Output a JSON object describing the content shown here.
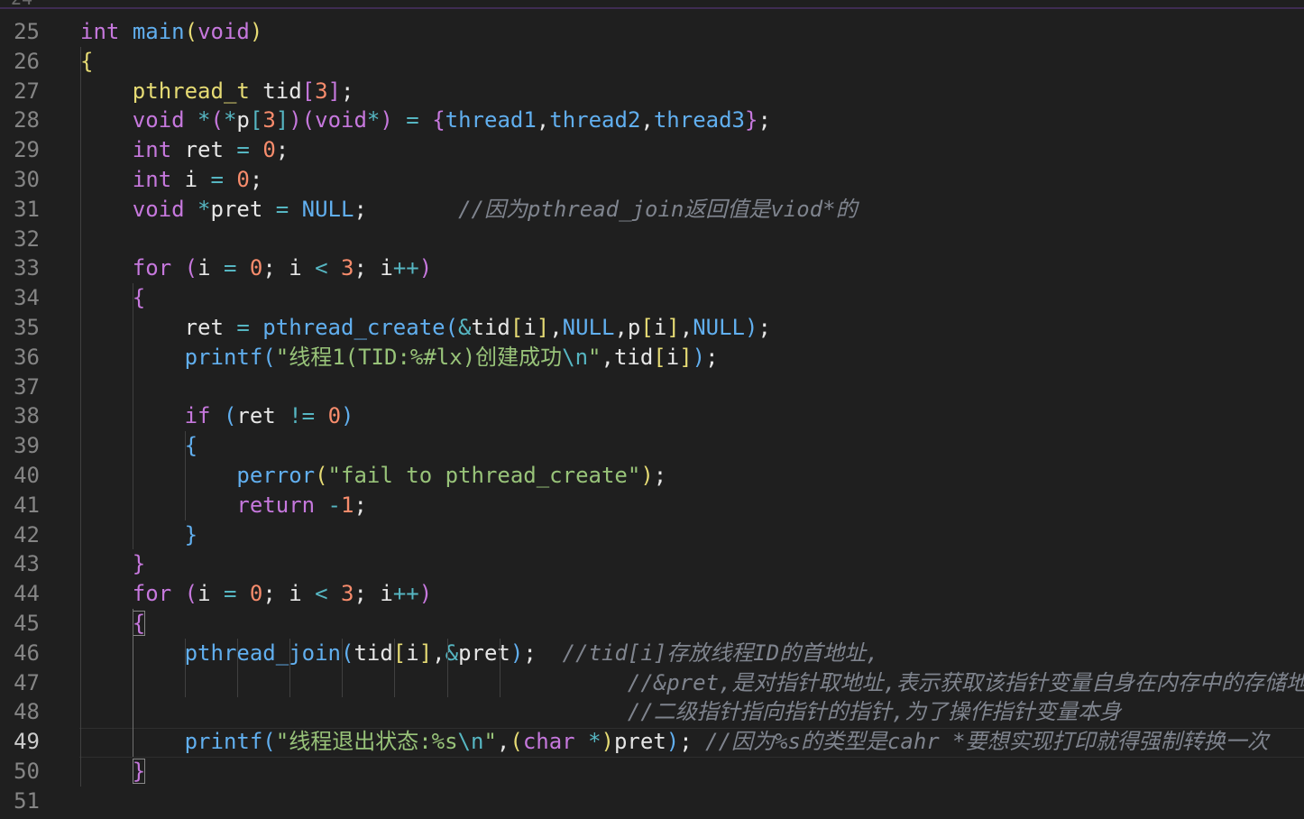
{
  "editor": {
    "partial_top_line": "24",
    "current_line": 49,
    "lines": [
      {
        "n": "25",
        "tokens": [
          [
            "t-purple",
            "int"
          ],
          [
            "t-white",
            " "
          ],
          [
            "t-blue",
            "main"
          ],
          [
            "t-yellow",
            "("
          ],
          [
            "t-purple",
            "void"
          ],
          [
            "t-yellow",
            ")"
          ]
        ]
      },
      {
        "n": "26",
        "tokens": [
          [
            "t-yellow",
            "{"
          ]
        ]
      },
      {
        "n": "27",
        "tokens": [
          [
            "t-white",
            "    "
          ],
          [
            "t-yellow",
            "pthread_t"
          ],
          [
            "t-white",
            " tid"
          ],
          [
            "t-purple",
            "["
          ],
          [
            "t-orange",
            "3"
          ],
          [
            "t-purple",
            "]"
          ],
          [
            "t-white",
            ";"
          ]
        ]
      },
      {
        "n": "28",
        "tokens": [
          [
            "t-white",
            "    "
          ],
          [
            "t-purple",
            "void"
          ],
          [
            "t-white",
            " "
          ],
          [
            "t-cyan",
            "*"
          ],
          [
            "t-purple",
            "("
          ],
          [
            "t-cyan",
            "*"
          ],
          [
            "t-white",
            "p"
          ],
          [
            "t-cyan",
            "["
          ],
          [
            "t-orange",
            "3"
          ],
          [
            "t-cyan",
            "]"
          ],
          [
            "t-purple",
            ")("
          ],
          [
            "t-purple",
            "void"
          ],
          [
            "t-cyan",
            "*"
          ],
          [
            "t-purple",
            ")"
          ],
          [
            "t-white",
            " "
          ],
          [
            "t-cyan",
            "="
          ],
          [
            "t-white",
            " "
          ],
          [
            "t-purple",
            "{"
          ],
          [
            "t-blue",
            "thread1"
          ],
          [
            "t-white",
            ","
          ],
          [
            "t-blue",
            "thread2"
          ],
          [
            "t-white",
            ","
          ],
          [
            "t-blue",
            "thread3"
          ],
          [
            "t-purple",
            "}"
          ],
          [
            "t-white",
            ";"
          ]
        ]
      },
      {
        "n": "29",
        "tokens": [
          [
            "t-white",
            "    "
          ],
          [
            "t-purple",
            "int"
          ],
          [
            "t-white",
            " ret "
          ],
          [
            "t-cyan",
            "="
          ],
          [
            "t-white",
            " "
          ],
          [
            "t-orange",
            "0"
          ],
          [
            "t-white",
            ";"
          ]
        ]
      },
      {
        "n": "30",
        "tokens": [
          [
            "t-white",
            "    "
          ],
          [
            "t-purple",
            "int"
          ],
          [
            "t-white",
            " i "
          ],
          [
            "t-cyan",
            "="
          ],
          [
            "t-white",
            " "
          ],
          [
            "t-orange",
            "0"
          ],
          [
            "t-white",
            ";"
          ]
        ]
      },
      {
        "n": "31",
        "tokens": [
          [
            "t-white",
            "    "
          ],
          [
            "t-purple",
            "void"
          ],
          [
            "t-white",
            " "
          ],
          [
            "t-cyan",
            "*"
          ],
          [
            "t-white",
            "pret "
          ],
          [
            "t-cyan",
            "="
          ],
          [
            "t-white",
            " "
          ],
          [
            "t-blue",
            "NULL"
          ],
          [
            "t-white",
            ";"
          ],
          [
            "t-white",
            "       "
          ],
          [
            "t-comment",
            "//因为pthread_join返回值是viod*的"
          ]
        ]
      },
      {
        "n": "32",
        "tokens": []
      },
      {
        "n": "33",
        "tokens": [
          [
            "t-white",
            "    "
          ],
          [
            "t-purple",
            "for"
          ],
          [
            "t-white",
            " "
          ],
          [
            "t-purple",
            "("
          ],
          [
            "t-white",
            "i "
          ],
          [
            "t-cyan",
            "="
          ],
          [
            "t-white",
            " "
          ],
          [
            "t-orange",
            "0"
          ],
          [
            "t-white",
            "; i "
          ],
          [
            "t-cyan",
            "<"
          ],
          [
            "t-white",
            " "
          ],
          [
            "t-orange",
            "3"
          ],
          [
            "t-white",
            "; i"
          ],
          [
            "t-cyan",
            "++"
          ],
          [
            "t-purple",
            ")"
          ]
        ]
      },
      {
        "n": "34",
        "tokens": [
          [
            "t-white",
            "    "
          ],
          [
            "t-purple",
            "{"
          ]
        ]
      },
      {
        "n": "35",
        "tokens": [
          [
            "t-white",
            "        ret "
          ],
          [
            "t-cyan",
            "="
          ],
          [
            "t-white",
            " "
          ],
          [
            "t-blue",
            "pthread_create"
          ],
          [
            "t-blue",
            "("
          ],
          [
            "t-cyan",
            "&"
          ],
          [
            "t-white",
            "tid"
          ],
          [
            "t-yellow",
            "["
          ],
          [
            "t-white",
            "i"
          ],
          [
            "t-yellow",
            "]"
          ],
          [
            "t-white",
            ","
          ],
          [
            "t-blue",
            "NULL"
          ],
          [
            "t-white",
            ",p"
          ],
          [
            "t-yellow",
            "["
          ],
          [
            "t-white",
            "i"
          ],
          [
            "t-yellow",
            "]"
          ],
          [
            "t-white",
            ","
          ],
          [
            "t-blue",
            "NULL"
          ],
          [
            "t-blue",
            ")"
          ],
          [
            "t-white",
            ";"
          ]
        ]
      },
      {
        "n": "36",
        "tokens": [
          [
            "t-white",
            "        "
          ],
          [
            "t-blue",
            "printf"
          ],
          [
            "t-blue",
            "("
          ],
          [
            "t-green",
            "\"线程1(TID:%#lx)创建成功"
          ],
          [
            "t-cyan",
            "\\n"
          ],
          [
            "t-green",
            "\""
          ],
          [
            "t-white",
            ",tid"
          ],
          [
            "t-yellow",
            "["
          ],
          [
            "t-white",
            "i"
          ],
          [
            "t-yellow",
            "]"
          ],
          [
            "t-blue",
            ")"
          ],
          [
            "t-white",
            ";"
          ]
        ]
      },
      {
        "n": "37",
        "tokens": []
      },
      {
        "n": "38",
        "tokens": [
          [
            "t-white",
            "        "
          ],
          [
            "t-purple",
            "if"
          ],
          [
            "t-white",
            " "
          ],
          [
            "t-blue",
            "("
          ],
          [
            "t-white",
            "ret "
          ],
          [
            "t-cyan",
            "!="
          ],
          [
            "t-white",
            " "
          ],
          [
            "t-orange",
            "0"
          ],
          [
            "t-blue",
            ")"
          ]
        ]
      },
      {
        "n": "39",
        "tokens": [
          [
            "t-white",
            "        "
          ],
          [
            "t-blue",
            "{"
          ]
        ]
      },
      {
        "n": "40",
        "tokens": [
          [
            "t-white",
            "            "
          ],
          [
            "t-blue",
            "perror"
          ],
          [
            "t-yellow",
            "("
          ],
          [
            "t-green",
            "\"fail to pthread_create\""
          ],
          [
            "t-yellow",
            ")"
          ],
          [
            "t-white",
            ";"
          ]
        ]
      },
      {
        "n": "41",
        "tokens": [
          [
            "t-white",
            "            "
          ],
          [
            "t-purple",
            "return"
          ],
          [
            "t-white",
            " "
          ],
          [
            "t-cyan",
            "-"
          ],
          [
            "t-orange",
            "1"
          ],
          [
            "t-white",
            ";"
          ]
        ]
      },
      {
        "n": "42",
        "tokens": [
          [
            "t-white",
            "        "
          ],
          [
            "t-blue",
            "}"
          ]
        ]
      },
      {
        "n": "43",
        "tokens": [
          [
            "t-white",
            "    "
          ],
          [
            "t-purple",
            "}"
          ]
        ]
      },
      {
        "n": "44",
        "tokens": [
          [
            "t-white",
            "    "
          ],
          [
            "t-purple",
            "for"
          ],
          [
            "t-white",
            " "
          ],
          [
            "t-purple",
            "("
          ],
          [
            "t-white",
            "i "
          ],
          [
            "t-cyan",
            "="
          ],
          [
            "t-white",
            " "
          ],
          [
            "t-orange",
            "0"
          ],
          [
            "t-white",
            "; i "
          ],
          [
            "t-cyan",
            "<"
          ],
          [
            "t-white",
            " "
          ],
          [
            "t-orange",
            "3"
          ],
          [
            "t-white",
            "; i"
          ],
          [
            "t-cyan",
            "++"
          ],
          [
            "t-purple",
            ")"
          ]
        ]
      },
      {
        "n": "45",
        "tokens": [
          [
            "t-white",
            "    "
          ],
          [
            "t-purple boxed",
            "{"
          ]
        ]
      },
      {
        "n": "46",
        "tokens": [
          [
            "t-white",
            "        "
          ],
          [
            "t-blue",
            "pthread_join"
          ],
          [
            "t-blue",
            "("
          ],
          [
            "t-white",
            "tid"
          ],
          [
            "t-yellow",
            "["
          ],
          [
            "t-white",
            "i"
          ],
          [
            "t-yellow",
            "]"
          ],
          [
            "t-white",
            ","
          ],
          [
            "t-cyan",
            "&"
          ],
          [
            "t-white",
            "pret"
          ],
          [
            "t-blue",
            ")"
          ],
          [
            "t-white",
            ";  "
          ],
          [
            "t-comment",
            "//tid[i]存放线程ID的首地址,"
          ]
        ]
      },
      {
        "n": "47",
        "tokens": [
          [
            "t-white",
            "                                          "
          ],
          [
            "t-comment",
            "//&pret,是对指针取地址,表示获取该指针变量自身在内存中的存储地址"
          ]
        ]
      },
      {
        "n": "48",
        "tokens": [
          [
            "t-white",
            "                                          "
          ],
          [
            "t-comment",
            "//二级指针指向指针的指针,为了操作指针变量本身"
          ]
        ]
      },
      {
        "n": "49",
        "tokens": [
          [
            "t-white",
            "        "
          ],
          [
            "t-blue",
            "printf"
          ],
          [
            "t-blue",
            "("
          ],
          [
            "t-green",
            "\"线程退出状态:%s"
          ],
          [
            "t-cyan",
            "\\n"
          ],
          [
            "t-green",
            "\""
          ],
          [
            "t-white",
            ","
          ],
          [
            "t-yellow",
            "("
          ],
          [
            "t-purple",
            "char"
          ],
          [
            "t-white",
            " "
          ],
          [
            "t-cyan",
            "*"
          ],
          [
            "t-yellow",
            ")"
          ],
          [
            "t-white",
            "pret"
          ],
          [
            "t-blue",
            ")"
          ],
          [
            "t-white",
            "; "
          ],
          [
            "t-comment",
            "//因为%s的类型是cahr *要想实现打印就得强制转换一次"
          ]
        ]
      },
      {
        "n": "50",
        "tokens": [
          [
            "t-white",
            "    "
          ],
          [
            "t-purple boxed",
            "}"
          ]
        ]
      },
      {
        "n": "51",
        "tokens": []
      }
    ]
  }
}
